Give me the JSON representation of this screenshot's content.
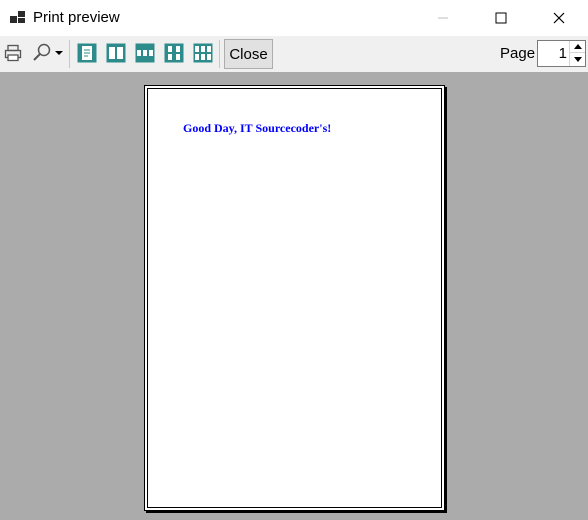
{
  "window": {
    "title": "Print preview",
    "controls": {
      "minimize": "minimize",
      "maximize": "maximize",
      "close": "close"
    }
  },
  "toolbar": {
    "icons": [
      "printer-icon",
      "zoom-icon",
      "one-page-icon",
      "two-pages-icon",
      "three-pages-icon",
      "four-pages-icon",
      "six-pages-icon"
    ],
    "close_label": "Close",
    "page_label": "Page",
    "page_value": "1"
  },
  "document": {
    "text": "Good Day, IT Sourcecoder's!",
    "text_color": "#0000ff"
  },
  "colors": {
    "preview_background": "#ababab",
    "icon_accent": "#2e8b8b"
  }
}
